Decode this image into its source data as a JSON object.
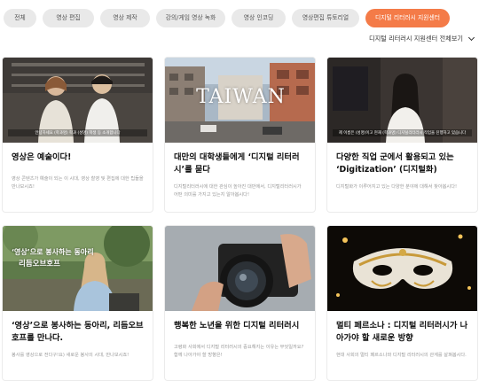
{
  "filters": [
    {
      "label": "전체",
      "active": false
    },
    {
      "label": "영상 편집",
      "active": false
    },
    {
      "label": "영상 제작",
      "active": false
    },
    {
      "label": "강의/게임 영상 녹화",
      "active": false
    },
    {
      "label": "영상 인코딩",
      "active": false
    },
    {
      "label": "영상편집 튜토리얼",
      "active": false
    },
    {
      "label": "디지털 리터러시 지원센터",
      "active": true
    }
  ],
  "view_all_label": "디지털 리터러시 지원센터 전체보기",
  "cards": [
    {
      "title": "영상은 예술이다!",
      "desc": "영상 콘텐츠가 예술이 되는 이 시대, 영상 촬영 및 편집에 대한 팁들을 만나보시죠!",
      "caption": "안녕하세요 (학과명) 학과 (성명) 학생 등 소개합니다"
    },
    {
      "title": "대만의 대학생들에게 ‘디지털 리터러시’를 묻다",
      "desc": "디지털리터러시에 대한 관심이 높아진 대만에서, 디지털리터러시가 어떤 의미를 가지고 있는지 알아봅시다!",
      "overlay": "TAIWAN"
    },
    {
      "title": "다양한 직업 군에서 활용되고 있는 ‘Digitization’ (디지털화)",
      "desc": "디지털화가 이루어지고 있는 다양한 분야에 대해서 찾아봅시다!",
      "caption": "제 이름은 (성명)이고 현재 (학과명) 디지털리터러시 작업을 진행하고 있습니다"
    },
    {
      "title": "‘영상’으로 봉사하는 동아리, 리듬오브호프를 만나다.",
      "desc": "봉사를 영상으로 전다구!요) 새로운 봉사의 시대, 만나보시죠!",
      "overlay": "‘영상’으로 봉사하는 동아리",
      "overlay_sub": "리듬오브호프"
    },
    {
      "title": "행복한 노년을 위한 디지털 리터러시",
      "desc": "고령화 사회에서 디지털 리터러시의 중요해지는 이유는 무엇일까요? 함께 나아가야 할 방향은!"
    },
    {
      "title": "멀티 페르소나 : 디지털 리터러시가 나아가야 할 새로운 방향",
      "desc": "현대 사회의 멀티 페르소나와 디지털 리터러시의 관계를 살펴봅시다."
    }
  ]
}
